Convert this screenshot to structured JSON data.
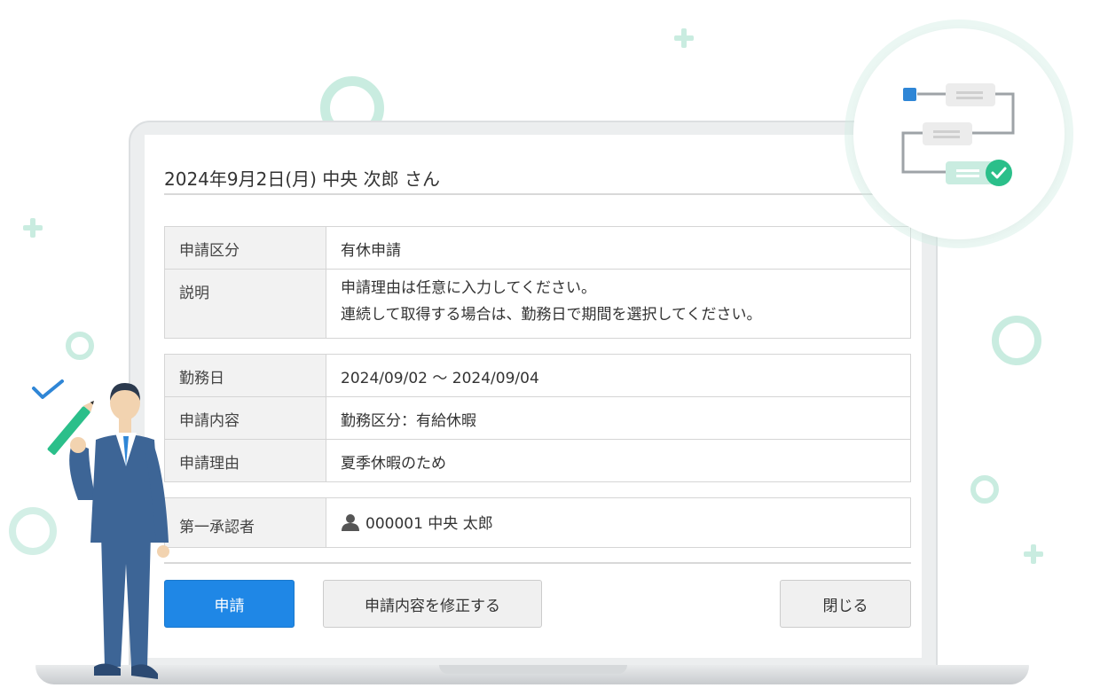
{
  "dialog": {
    "title": "2024年9月2日(月)  中央 次郎 さん",
    "rows_group1": [
      {
        "label": "申請区分",
        "value_lines": [
          "有休申請"
        ]
      },
      {
        "label": "説明",
        "value_lines": [
          "申請理由は任意に入力してください。",
          "連続して取得する場合は、勤務日で期間を選択してください。"
        ]
      }
    ],
    "rows_group2": [
      {
        "label": "勤務日",
        "value_lines": [
          "2024/09/02  ～  2024/09/04"
        ]
      },
      {
        "label": "申請内容",
        "value_lines": [
          "勤務区分：有給休暇"
        ]
      },
      {
        "label": "申請理由",
        "value_lines": [
          "夏季休暇のため"
        ]
      }
    ],
    "approver": {
      "label": "第一承認者",
      "value": "000001 中央 太郎",
      "icon": "user-icon"
    },
    "buttons": {
      "submit": "申請",
      "edit": "申請内容を修正する",
      "close": "閉じる"
    }
  },
  "colors": {
    "primary": "#1f87e6",
    "accent_mint": "#c9ece0",
    "suit": "#3d6596",
    "check_green": "#2bbf8a"
  }
}
